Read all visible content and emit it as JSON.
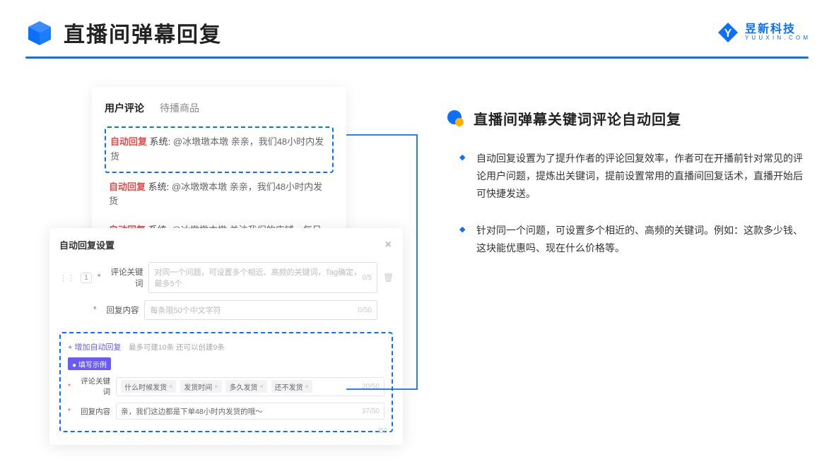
{
  "header": {
    "title": "直播间弹幕回复",
    "logo_main": "昱新科技",
    "logo_sub": "Y U U X I N . C O M"
  },
  "comments": {
    "tab_active": "用户评论",
    "tab_other": "待播商品",
    "items": [
      {
        "tag": "自动回复",
        "sys": "系统:",
        "text": "@冰墩墩本墩 亲亲，我们48小时内发货"
      },
      {
        "tag": "自动回复",
        "sys": "系统:",
        "text": "@冰墩墩本墩 亲亲，我们48小时内发货"
      },
      {
        "tag": "自动回复",
        "sys": "系统:",
        "text": "@冰墩墩本墩 关注我们的店铺，每日都有热门推荐呦～"
      }
    ]
  },
  "modal": {
    "title": "自动回复设置",
    "row_num": "1",
    "labels": {
      "keyword": "评论关键词",
      "reply": "回复内容"
    },
    "placeholders": {
      "keyword": "对同一个问题，可设置多个相近、高频的关键词，Tag确定，最多5个",
      "reply": "每条限50个中文字符"
    },
    "counters": {
      "kw": "0/5",
      "reply": "0/50"
    },
    "add_text": "+ 增加自动回复",
    "add_sub": "最多可建10条 还可以创建9条",
    "badge": "● 填写示例",
    "ex_labels": {
      "keyword": "评论关键词",
      "reply": "回复内容"
    },
    "ex_tags": [
      "什么时候发货",
      "发货时间",
      "多久发货",
      "还不发货"
    ],
    "ex_kw_counter": "20/50",
    "ex_reply": "亲，我们这边都是下单48小时内发货的哦～",
    "ex_reply_counter": "37/50",
    "outside_counter": "/50"
  },
  "right": {
    "section_title": "直播间弹幕关键词评论自动回复",
    "bullets": [
      "自动回复设置为了提升作者的评论回复效率，作者可在开播前针对常见的评论用户问题，提炼出关键词，提前设置常用的直播间回复话术，直播开始后可快捷发送。",
      "针对同一个问题，可设置多个相近的、高频的关键词。例如：这款多少钱、这块能优惠吗、现在什么价格等。"
    ]
  }
}
